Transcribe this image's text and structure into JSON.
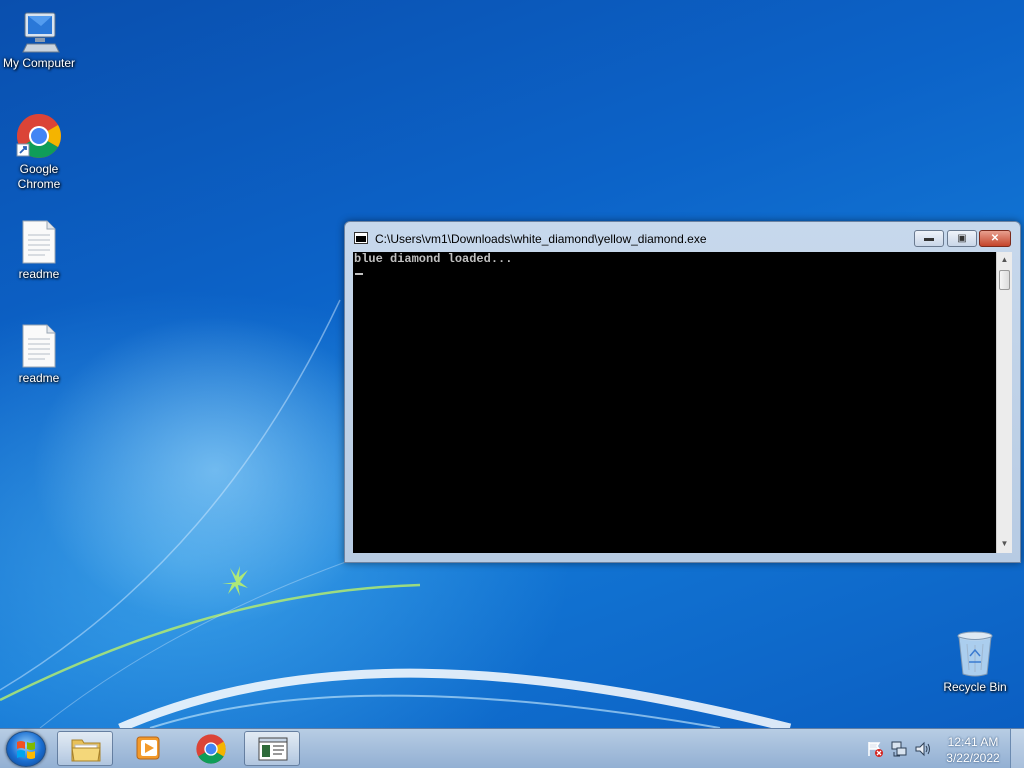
{
  "desktop": {
    "icons": [
      {
        "label": "My Computer"
      },
      {
        "label": "Google\nChrome"
      },
      {
        "label": "readme"
      },
      {
        "label": "readme"
      },
      {
        "label": "Recycle Bin"
      }
    ]
  },
  "window": {
    "title": "C:\\Users\\vm1\\Downloads\\white_diamond\\yellow_diamond.exe",
    "console_output": "blue diamond loaded..."
  },
  "taskbar": {
    "apps": [
      "file-explorer",
      "media-player",
      "google-chrome",
      "console-window"
    ],
    "clock": {
      "time": "12:41 AM",
      "date": "3/22/2022"
    }
  },
  "colors": {
    "console_bg": "#000000",
    "console_text": "#c0c0c0",
    "close_button": "#c4442a"
  }
}
